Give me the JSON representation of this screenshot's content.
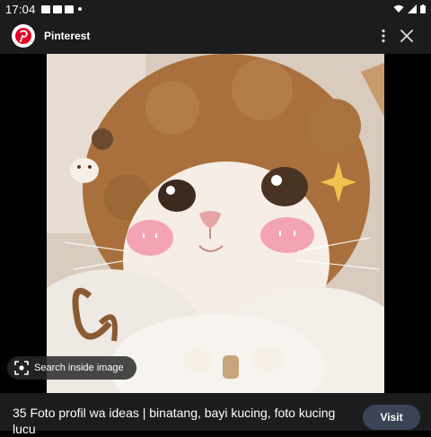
{
  "status_bar": {
    "time": "17:04",
    "icons": [
      "image-icon",
      "youtube-icon",
      "youtube-icon",
      "dot-icon",
      "wifi-icon",
      "signal-icon",
      "battery-icon"
    ]
  },
  "app_bar": {
    "title": "Pinterest",
    "logo": "pinterest-logo",
    "actions": [
      "more-vertical-icon",
      "close-icon"
    ]
  },
  "image": {
    "subject": "cat-in-knitted-hat",
    "search_label": "Search inside image"
  },
  "result": {
    "title_line1": "35 Foto profil wa ideas | binatang, bayi kucing, foto kucing",
    "title_line2": "lucu",
    "visit_label": "Visit"
  },
  "colors": {
    "bar_bg": "#1c1c1e",
    "visit_bg": "#3a4456",
    "pinterest_red": "#e60023"
  }
}
